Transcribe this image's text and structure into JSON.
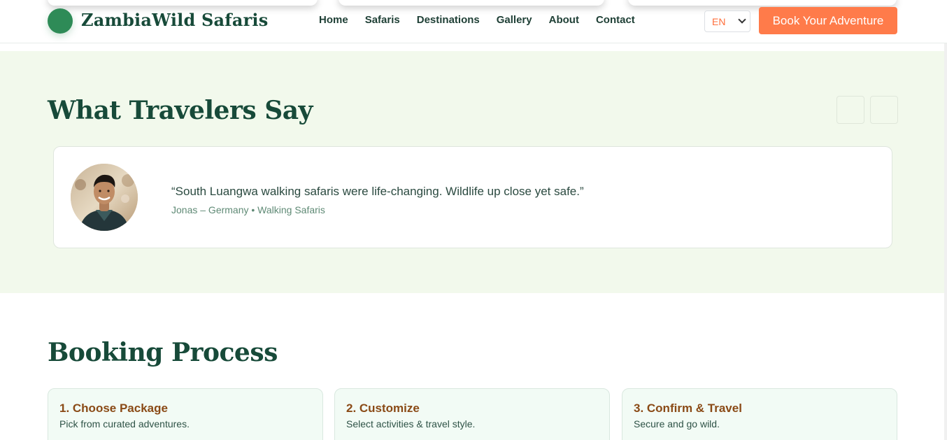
{
  "header": {
    "brand": "ZambiaWild Safaris",
    "nav": [
      "Home",
      "Safaris",
      "Destinations",
      "Gallery",
      "About",
      "Contact"
    ],
    "language": {
      "selected": "EN",
      "options": [
        "EN"
      ]
    },
    "book_button": "Book Your Adventure"
  },
  "testimonials": {
    "title": "What Travelers Say",
    "items": [
      {
        "quote": "“South Luangwa walking safaris were life-changing. Wildlife up close yet safe.”",
        "author": "Jonas – Germany • Walking Safaris"
      }
    ]
  },
  "booking": {
    "title": "Booking Process",
    "steps": [
      {
        "title": "1. Choose Package",
        "desc": "Pick from curated adventures."
      },
      {
        "title": "2. Customize",
        "desc": "Select activities & travel style."
      },
      {
        "title": "3. Confirm & Travel",
        "desc": "Secure and go wild."
      }
    ]
  },
  "colors": {
    "brand": "#174a39",
    "accent": "#ff7b4a",
    "section_bg": "#f2f9ec",
    "step_title": "#8a4a16"
  }
}
